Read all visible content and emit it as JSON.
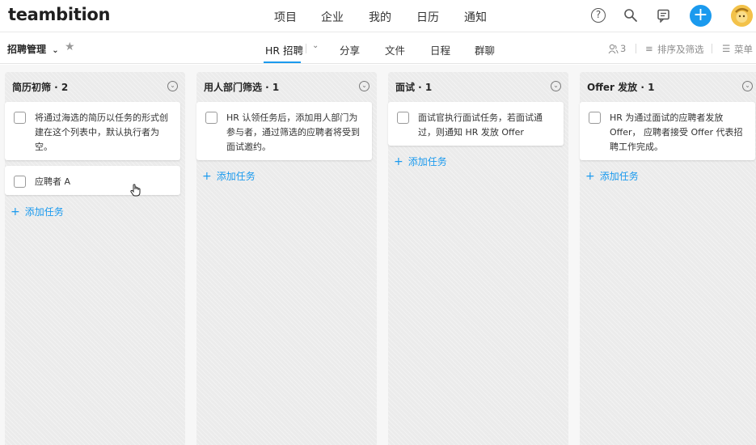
{
  "app": {
    "logo": "teambition",
    "nav": [
      "项目",
      "企业",
      "我的",
      "日历",
      "通知"
    ],
    "icons": {
      "help": "help-icon",
      "search": "search-icon",
      "chat": "chat-icon",
      "add": "plus-icon",
      "avatar": "avatar"
    }
  },
  "subbar": {
    "project_name": "招聘管理",
    "tabs": [
      "HR 招聘",
      "分享",
      "文件",
      "日程",
      "群聊"
    ],
    "active_tab": "HR 招聘",
    "member_count": "3",
    "sort_filter": "排序及筛选",
    "menu": "菜单"
  },
  "board": {
    "add_task_label": "添加任务",
    "columns": [
      {
        "title": "简历初筛 · 2",
        "cards": [
          "将通过海选的简历以任务的形式创建在这个列表中，默认执行者为空。",
          "应聘者 A"
        ]
      },
      {
        "title": "用人部门筛选 · 1",
        "cards": [
          "HR 认领任务后，添加用人部门为参与者，通过筛选的应聘者将受到面试邀约。"
        ]
      },
      {
        "title": "面试 · 1",
        "cards": [
          "面试官执行面试任务，若面试通过，则通知 HR 发放 Offer"
        ]
      },
      {
        "title": "Offer 发放 · 1",
        "cards": [
          "HR 为通过面试的应聘者发放Offer， 应聘者接受 Offer 代表招聘工作完成。"
        ]
      }
    ]
  },
  "colors": {
    "accent": "#1b9aee",
    "column_bg": "#ebebeb"
  }
}
